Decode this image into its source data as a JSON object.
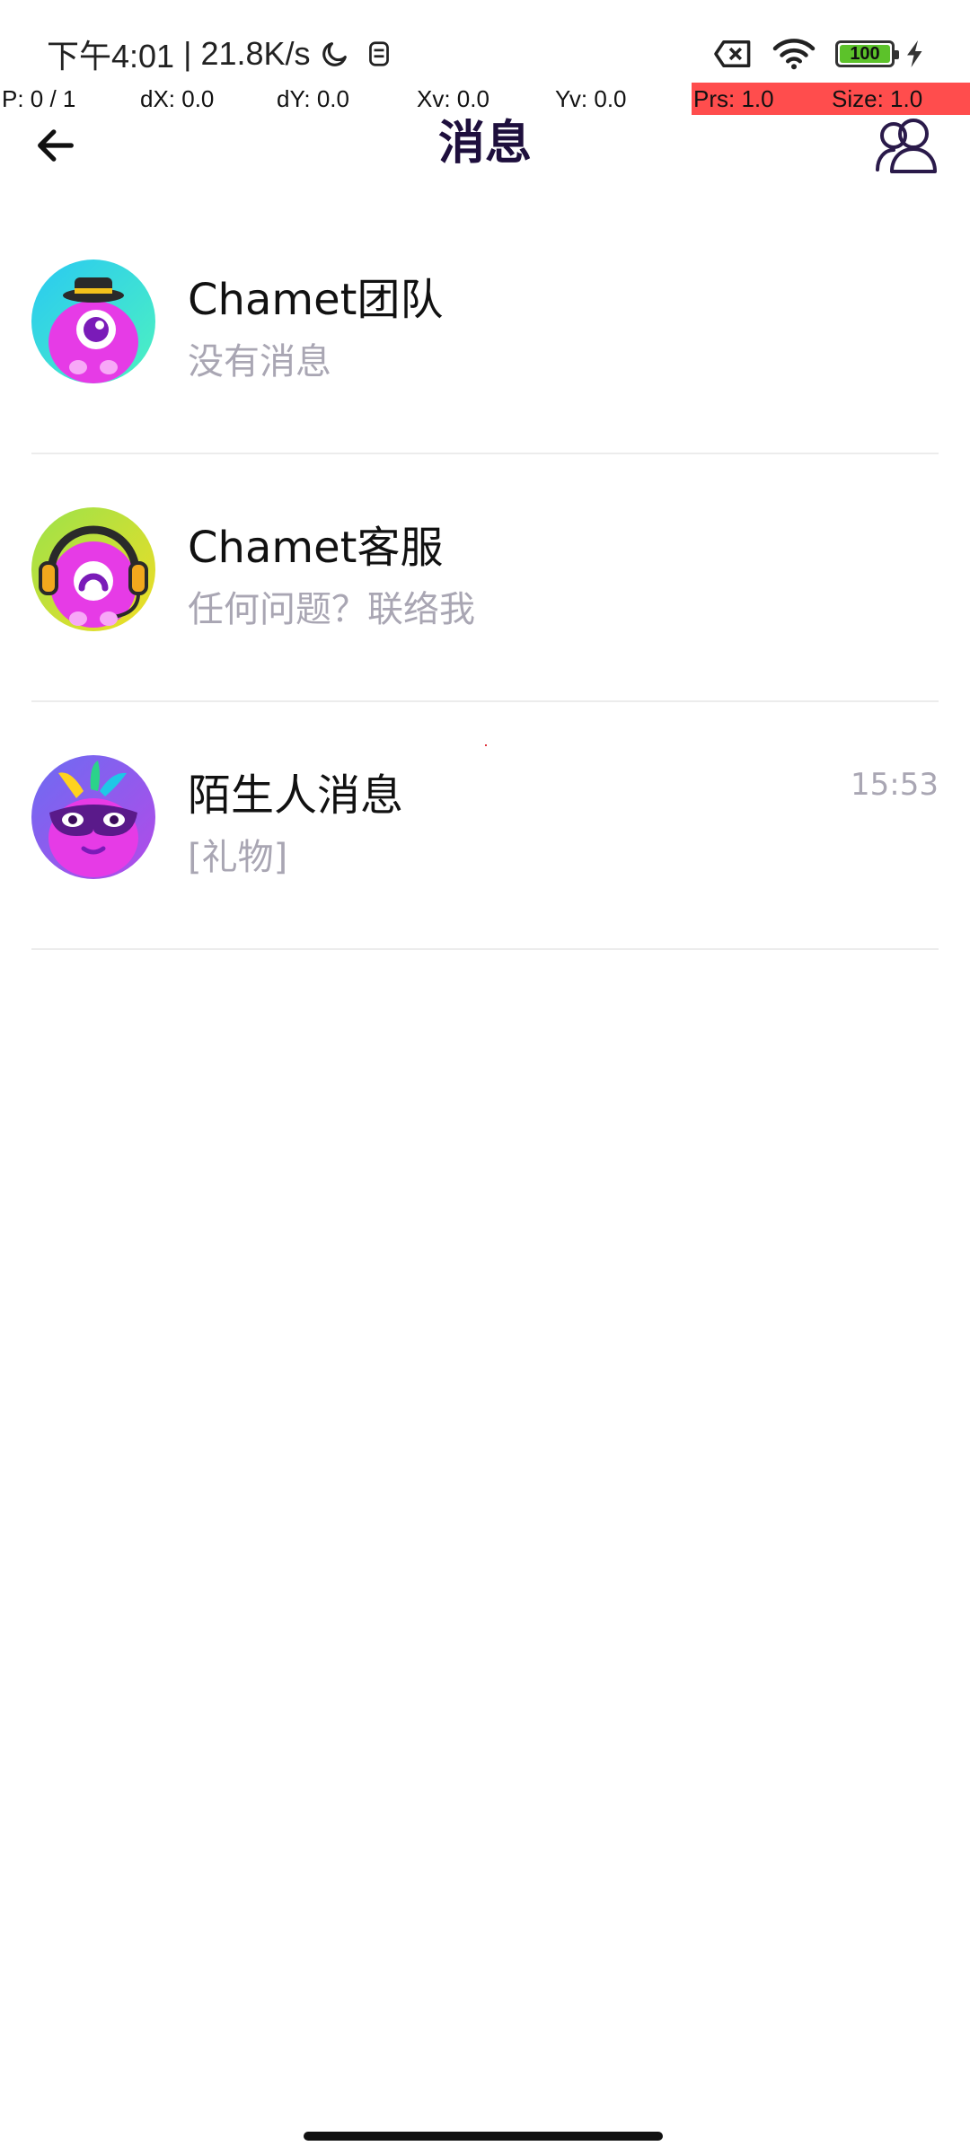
{
  "status_bar": {
    "time": "下午4:01",
    "separator": "|",
    "net_speed": "21.8K/s",
    "battery_level": "100",
    "icons": [
      "moon-icon",
      "notification-app-icon",
      "sim-x-icon",
      "wifi-icon",
      "battery-icon",
      "charging-bolt-icon"
    ]
  },
  "debug_overlay": {
    "pointer": "P: 0 / 1",
    "dx": "dX: 0.0",
    "dy": "dY: 0.0",
    "xv": "Xv: 0.0",
    "yv": "Yv: 0.0",
    "prs": "Prs: 1.0",
    "size": "Size: 1.0",
    "highlight_color": "#ff4d4d"
  },
  "header": {
    "title": "消息",
    "back_icon": "arrow-left-icon",
    "contacts_icon": "group-users-icon",
    "title_color": "#1e0f3d"
  },
  "conversations": [
    {
      "name": "Chamet团队",
      "preview": "没有消息",
      "time": "",
      "avatar_icon": "chamet-team-mascot-icon"
    },
    {
      "name": "Chamet客服",
      "preview": "任何问题？联络我",
      "time": "",
      "avatar_icon": "chamet-support-mascot-icon"
    },
    {
      "name": "陌生人消息",
      "preview": "[礼物]",
      "time": "15:53",
      "avatar_icon": "stranger-message-mascot-icon"
    }
  ],
  "colors": {
    "secondary_text": "#a9a6b3",
    "primary_text": "#111111",
    "divider": "#ececec",
    "mascot_pink": "#e63be6"
  }
}
